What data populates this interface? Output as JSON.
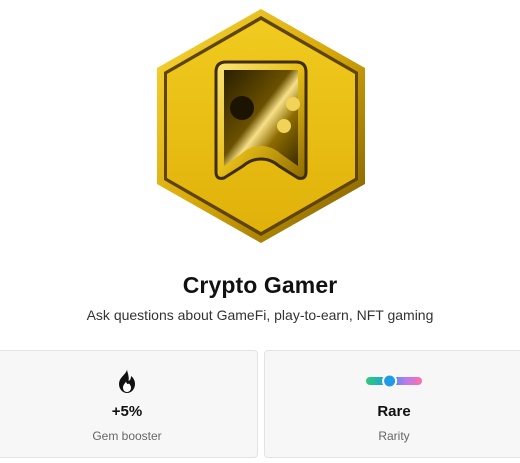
{
  "badge": {
    "icon": "gamepad-icon",
    "colors": {
      "gold_light": "#f6d22a",
      "gold_mid": "#e0b40b",
      "gold_dark": "#6e5200"
    }
  },
  "title": "Crypto Gamer",
  "description": "Ask questions about GameFi, play-to-earn, NFT gaming",
  "stats": {
    "booster": {
      "icon": "fire-icon",
      "value": "+5%",
      "label": "Gem booster"
    },
    "rarity": {
      "icon": "rarity-slider-icon",
      "value": "Rare",
      "label": "Rarity",
      "level": 0.4,
      "colors": [
        "#2ecc71",
        "#1e9be9",
        "#b57cf0",
        "#ff6fa8"
      ]
    }
  }
}
